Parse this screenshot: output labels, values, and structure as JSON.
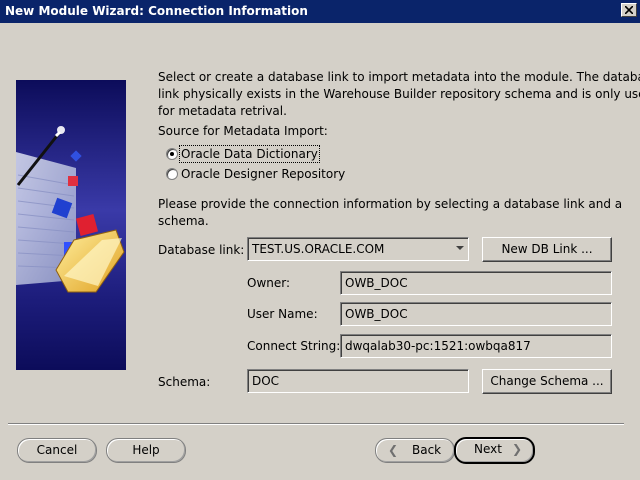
{
  "window": {
    "title": "New Module Wizard: Connection Information"
  },
  "description": [
    "Select or create a database link to import metadata into the module.  The database",
    "link physically exists in the Warehouse Builder repository schema and is only used",
    "for metadata retrival."
  ],
  "source": {
    "label": "Source for Metadata Import:",
    "options": [
      {
        "label": "Oracle Data Dictionary",
        "selected": true
      },
      {
        "label": "Oracle Designer Repository",
        "selected": false
      }
    ]
  },
  "connection_text": [
    "Please provide the connection information by selecting a database link and a",
    "schema."
  ],
  "form": {
    "database_link_label": "Database link:",
    "database_link_value": "TEST.US.ORACLE.COM",
    "new_db_link_button": "New DB Link ...",
    "owner_label": "Owner:",
    "owner_value": "OWB_DOC",
    "user_name_label": "User Name:",
    "user_name_value": "OWB_DOC",
    "connect_string_label": "Connect String:",
    "connect_string_value": "dwqalab30-pc:1521:owbqa817",
    "schema_label": "Schema:",
    "schema_value": "DOC",
    "change_schema_button": "Change Schema ..."
  },
  "footer": {
    "cancel": "Cancel",
    "help": "Help",
    "back": "Back",
    "next": "Next"
  },
  "colors": {
    "titlebar": "#0a246a",
    "dialog_bg": "#d4d0c8",
    "art_bg": "#1a1a6e"
  }
}
